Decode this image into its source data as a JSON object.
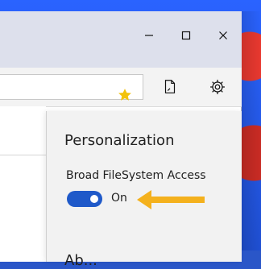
{
  "window": {
    "controls": {
      "minimize_icon": "minimize-icon",
      "maximize_icon": "maximize-icon",
      "close_icon": "close-icon"
    }
  },
  "toolbar": {
    "favorite_icon": "star-icon",
    "notes_icon": "notes-icon",
    "settings_icon": "gear-icon"
  },
  "settings_panel": {
    "title": "Personalization",
    "setting_label": "Broad FileSystem Access",
    "toggle_state": "On",
    "next_section_partial": "Ab..."
  },
  "colors": {
    "accent": "#1f59c9",
    "highlight_arrow": "#f4b11d",
    "favorite_star": "#f2c20c"
  }
}
